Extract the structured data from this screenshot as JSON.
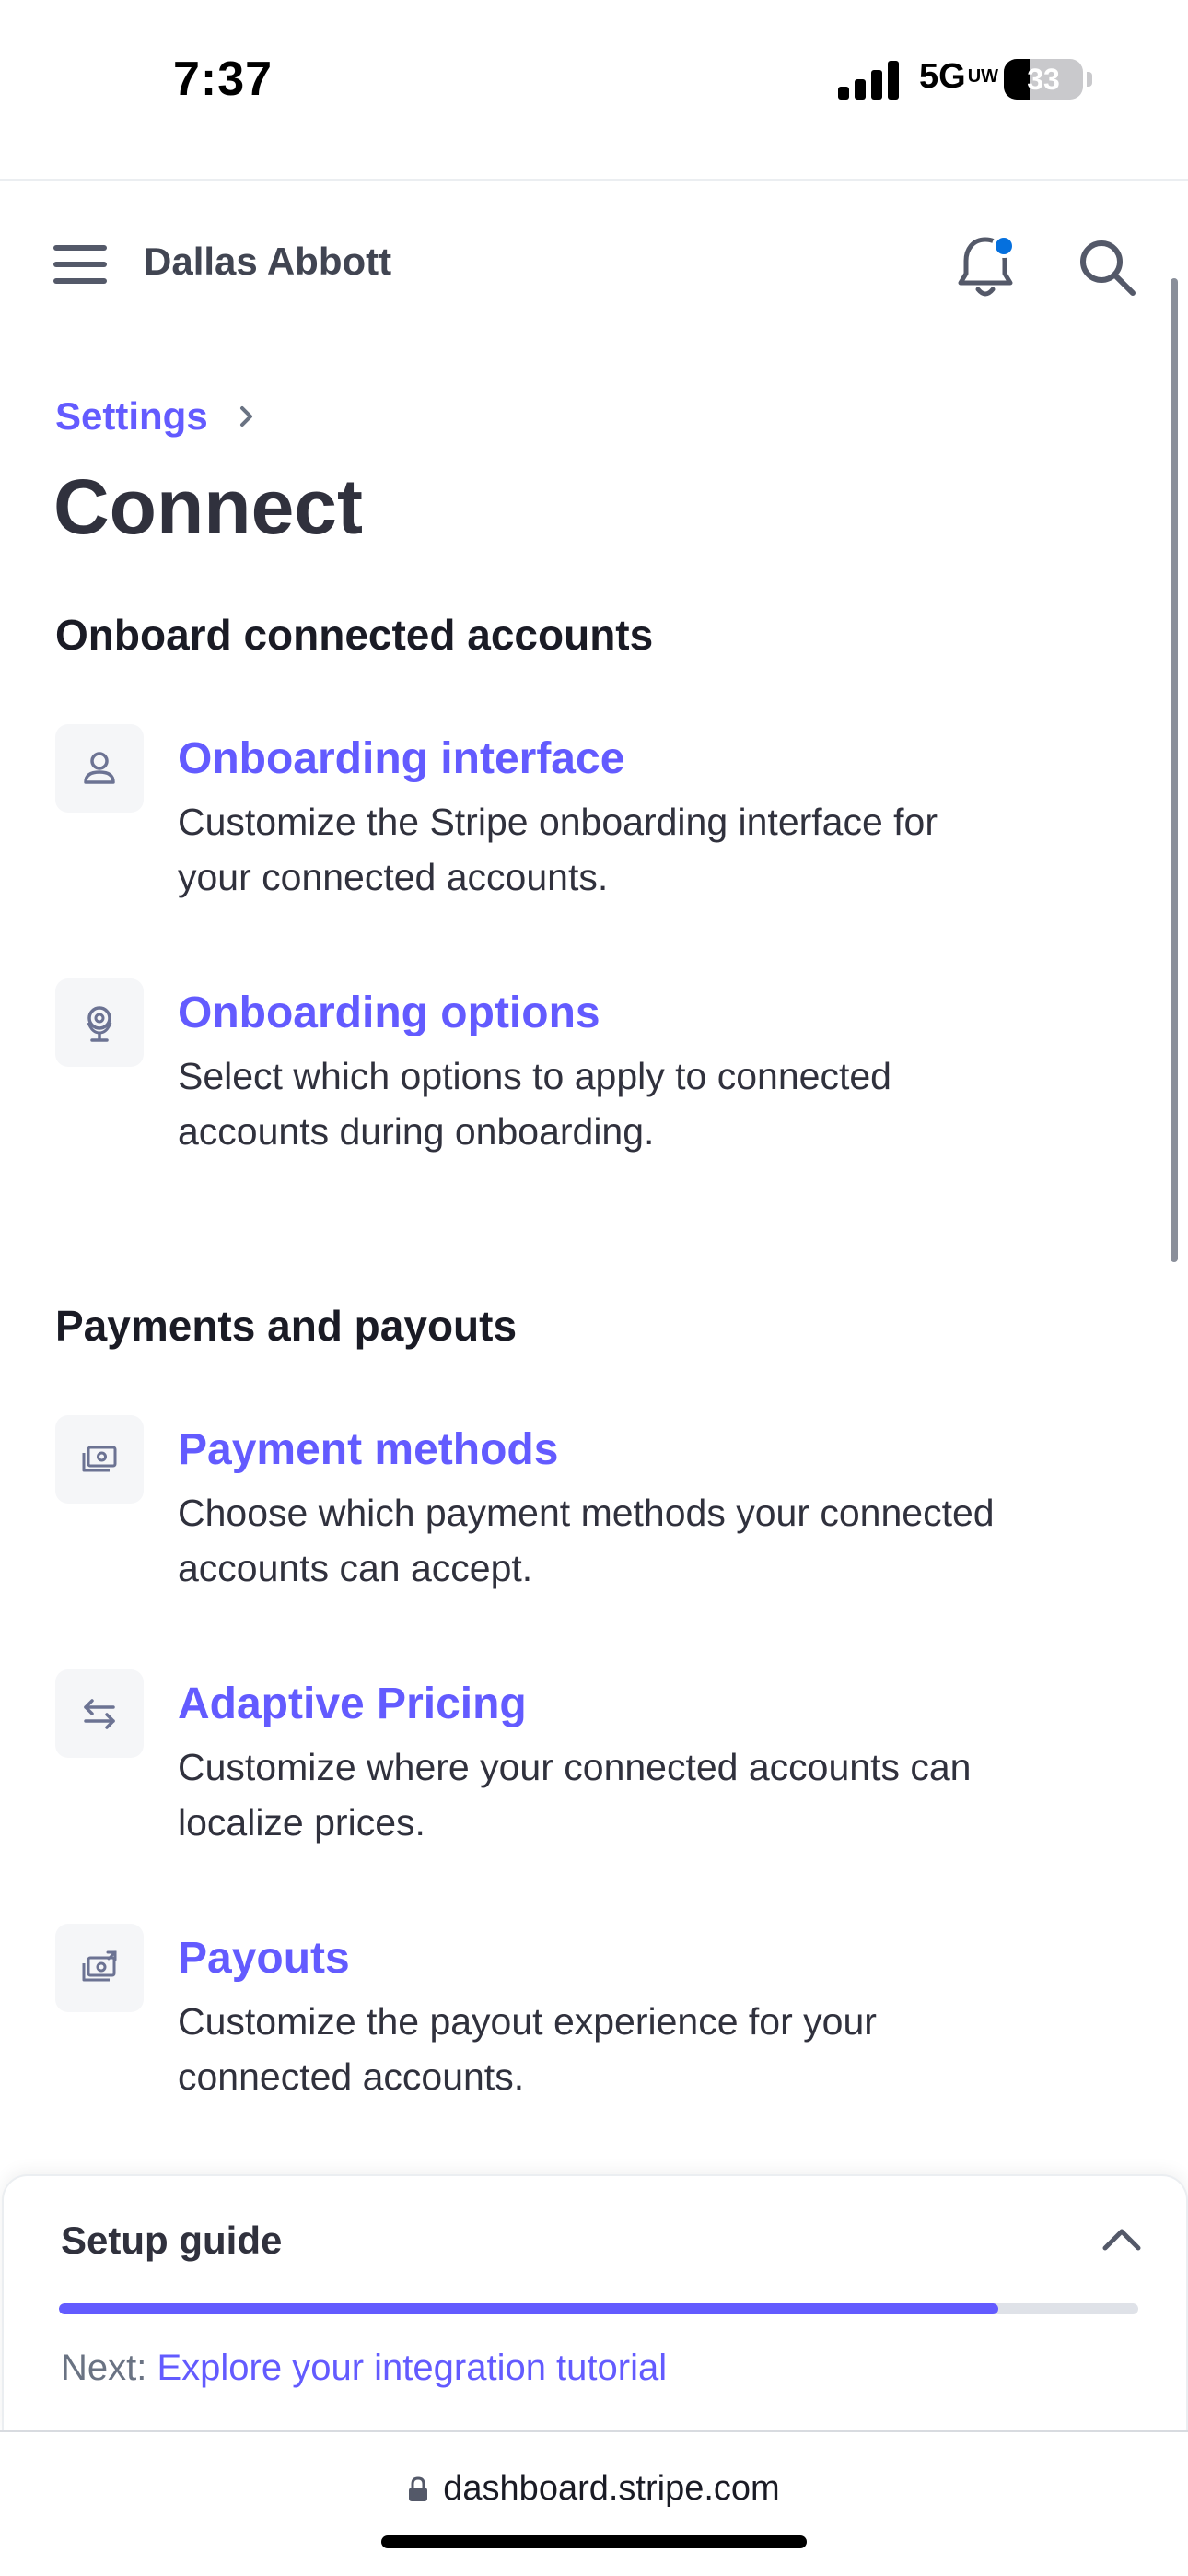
{
  "status_bar": {
    "time": "7:37",
    "network": "5G",
    "network_suffix": "UW",
    "battery_level": "33",
    "battery_fraction": 0.33
  },
  "header": {
    "account_name": "Dallas Abbott",
    "menu_icon": "hamburger-menu-icon",
    "notifications_icon": "bell-icon",
    "notification_dot_color": "#0570de",
    "search_icon": "search-icon"
  },
  "breadcrumb": {
    "parent": "Settings"
  },
  "page": {
    "title": "Connect"
  },
  "sections": [
    {
      "title": "Onboard connected accounts",
      "items": [
        {
          "title": "Onboarding interface",
          "description": "Customize the Stripe onboarding interface for your connected accounts.",
          "icon": "person-icon"
        },
        {
          "title": "Onboarding options",
          "description": "Select which options to apply to connected accounts during onboarding.",
          "icon": "globe-stand-icon"
        }
      ]
    },
    {
      "title": "Payments and payouts",
      "items": [
        {
          "title": "Payment methods",
          "description": "Choose which payment methods your connected accounts can accept.",
          "icon": "payment-methods-icon"
        },
        {
          "title": "Adaptive Pricing",
          "description": "Customize where your connected accounts can localize prices.",
          "icon": "arrows-exchange-icon"
        },
        {
          "title": "Payouts",
          "description": "Customize the payout experience for your connected accounts.",
          "icon": "payouts-icon"
        }
      ]
    }
  ],
  "setup_guide": {
    "title": "Setup guide",
    "progress": 0.87,
    "next_label": "Next:",
    "next_link": "Explore your integration tutorial"
  },
  "browser": {
    "url": "dashboard.stripe.com"
  },
  "colors": {
    "accent": "#635bff",
    "text": "#30313d",
    "muted": "#6a7383"
  }
}
